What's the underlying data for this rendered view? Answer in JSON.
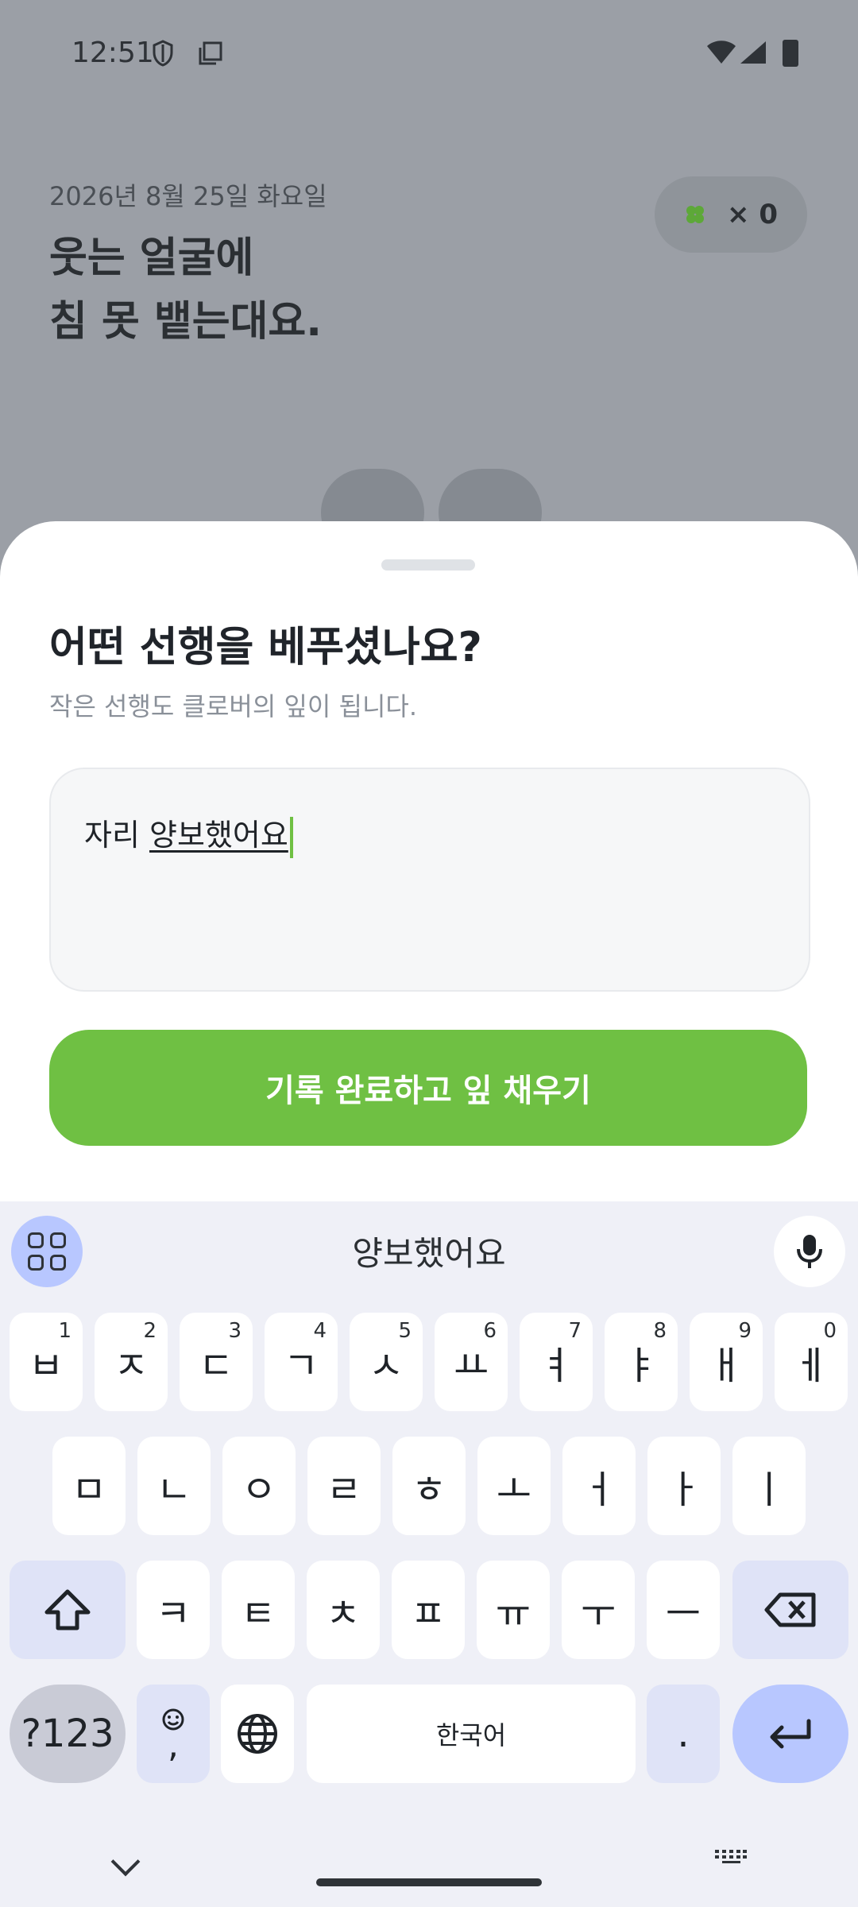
{
  "status_bar": {
    "time": "12:51"
  },
  "header": {
    "date": "2026년 8월 25일 화요일",
    "headline_line1": "웃는 얼굴에",
    "headline_line2": "침 못 뱉는대요.",
    "clover_count": "× 0"
  },
  "sheet": {
    "title": "어떤 선행을 베푸셨나요?",
    "subtitle": "작은 선행도 클로버의 잎이 됩니다.",
    "input_value_plain": "자리 ",
    "input_value_composing": "양보했어요",
    "submit_label": "기록 완료하고 잎 채우기"
  },
  "keyboard": {
    "suggestion": "양보했어요",
    "row1": [
      {
        "k": "ㅂ",
        "n": "1"
      },
      {
        "k": "ㅈ",
        "n": "2"
      },
      {
        "k": "ㄷ",
        "n": "3"
      },
      {
        "k": "ㄱ",
        "n": "4"
      },
      {
        "k": "ㅅ",
        "n": "5"
      },
      {
        "k": "ㅛ",
        "n": "6"
      },
      {
        "k": "ㅕ",
        "n": "7"
      },
      {
        "k": "ㅑ",
        "n": "8"
      },
      {
        "k": "ㅐ",
        "n": "9"
      },
      {
        "k": "ㅔ",
        "n": "0"
      }
    ],
    "row2": [
      "ㅁ",
      "ㄴ",
      "ㅇ",
      "ㄹ",
      "ㅎ",
      "ㅗ",
      "ㅓ",
      "ㅏ",
      "ㅣ"
    ],
    "row3": [
      "ㅋ",
      "ㅌ",
      "ㅊ",
      "ㅍ",
      "ㅠ",
      "ㅜ",
      "ㅡ"
    ],
    "symbols_label": "?123",
    "emoji_comma_label": ",",
    "space_label": "한국어",
    "period_label": "."
  },
  "colors": {
    "accent": "#6fc043",
    "dim_bg": "#9b9fa6",
    "keyboard_bg": "#eff0f7"
  }
}
